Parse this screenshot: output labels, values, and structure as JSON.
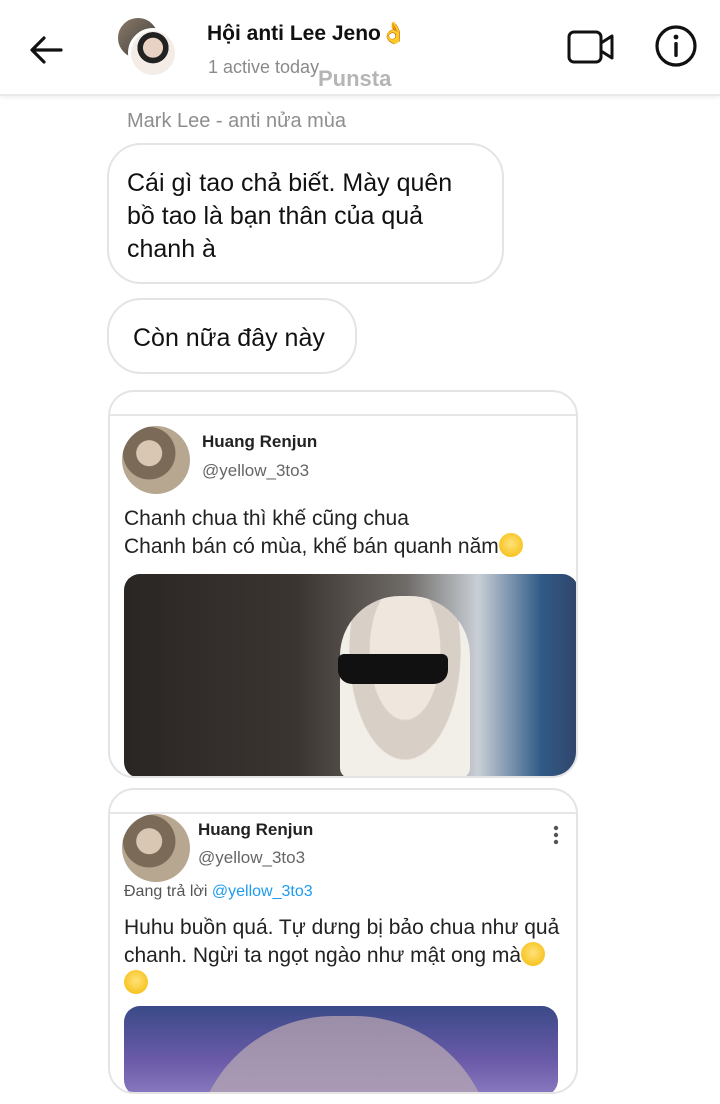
{
  "header": {
    "back_icon": "arrow-left-icon",
    "title": "Hội anti Lee Jeno👌",
    "status": "1 active today",
    "watermark": "Punsta",
    "video_icon": "video-camera-icon",
    "info_icon": "info-icon"
  },
  "chat": {
    "sender_name": "Mark Lee - anti nửa mùa",
    "messages": [
      {
        "text": "Cái gì tao chả biết. Mày quên bồ tao là bạn thân của quả chanh à"
      },
      {
        "text": "Còn nữa đây này"
      }
    ],
    "shared_posts": [
      {
        "name": "Huang Renjun",
        "handle": "@yellow_3to3",
        "line1": "Chanh chua thì khế cũng chua",
        "line2": "Chanh bán có mùa, khế bán quanh năm",
        "media": "photo of person with sunglasses"
      },
      {
        "name": "Huang Renjun",
        "handle": "@yellow_3to3",
        "reply_prefix": "Đang trả lời",
        "reply_to": "@yellow_3to3",
        "text": "Huhu buồn quá. Tự dưng bị bảo chua như quả chanh. Ngừi ta ngọt ngào như mật ong mà",
        "media": "photo of person with purple hair"
      }
    ]
  },
  "colors": {
    "link": "#1d9bf0",
    "muted": "#8e8e8e",
    "bubble_border": "#e4e4e4"
  }
}
